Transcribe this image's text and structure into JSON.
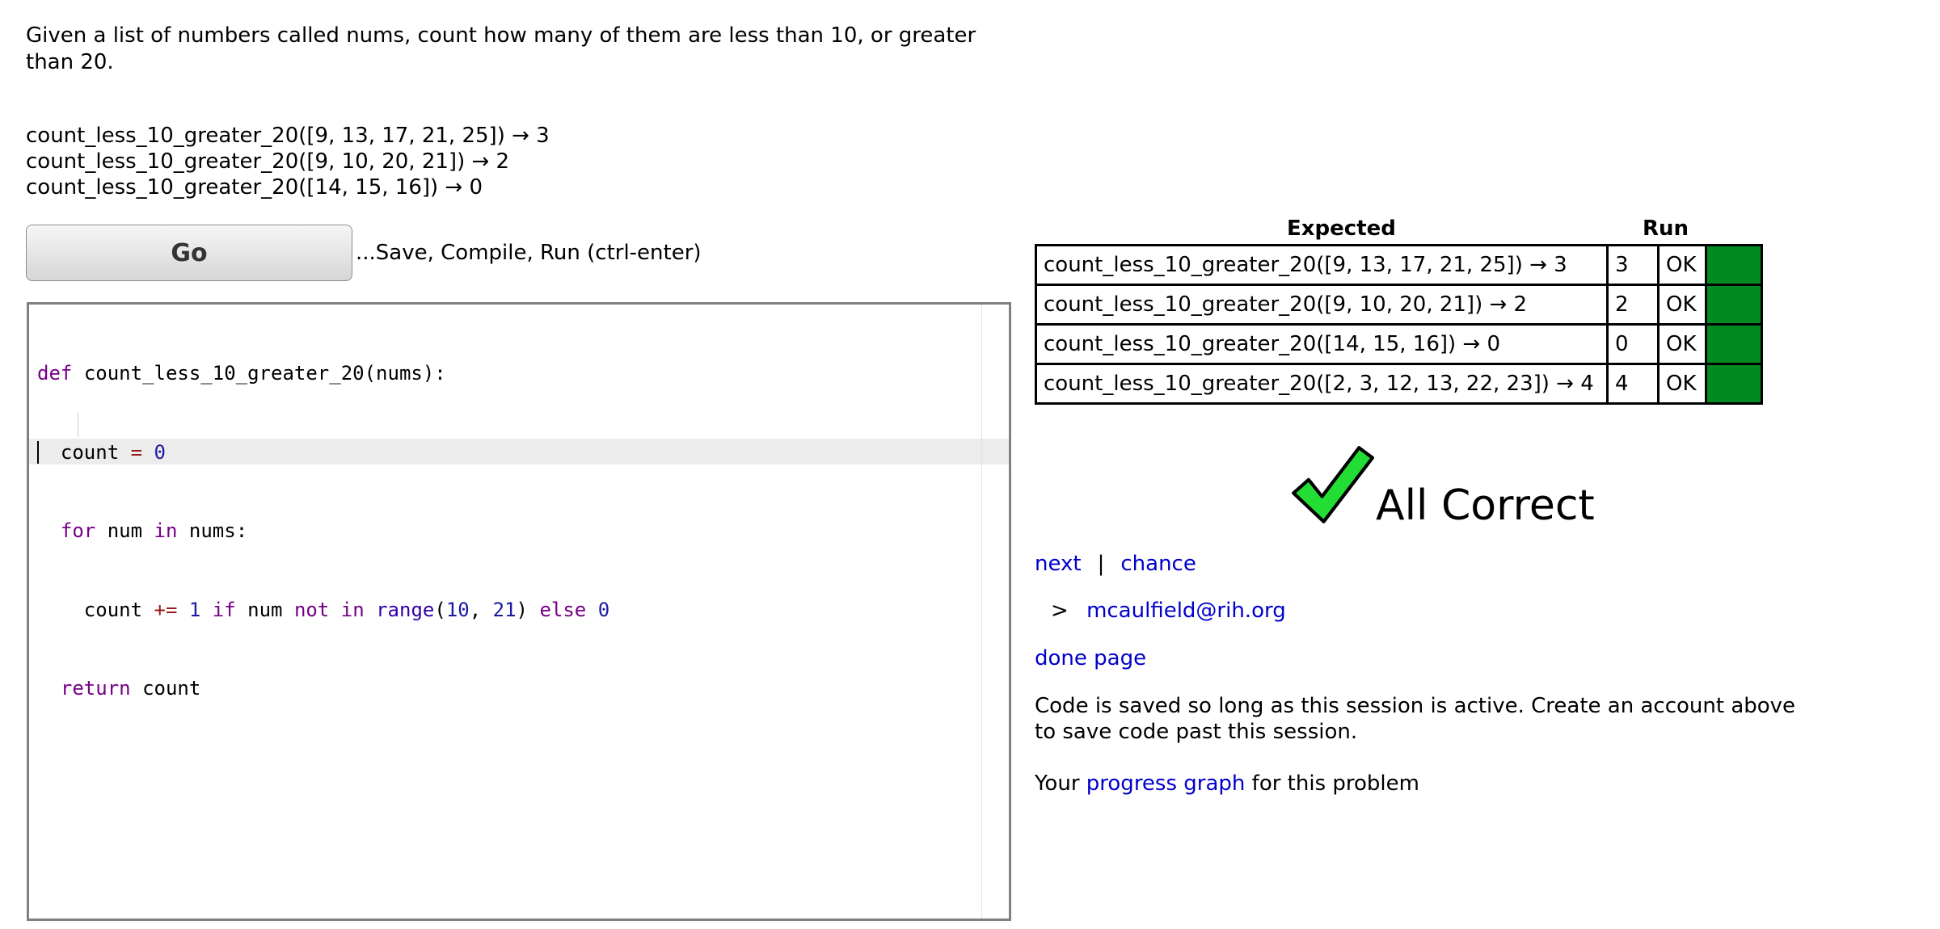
{
  "problem": {
    "description": "Given a list of numbers called nums, count how many of them are less than 10, or greater than 20.",
    "examples": [
      "count_less_10_greater_20([9, 13, 17, 21, 25]) → 3",
      "count_less_10_greater_20([9, 10, 20, 21]) → 2",
      "count_less_10_greater_20([14, 15, 16]) → 0"
    ]
  },
  "toolbar": {
    "go_label": "Go",
    "go_hint": "...Save, Compile, Run (ctrl-enter)"
  },
  "editor": {
    "lines": [
      "def count_less_10_greater_20(nums):",
      "  count = 0",
      "  for num in nums:",
      "    count += 1 if num not in range(10, 21) else 0",
      "  return count",
      ""
    ]
  },
  "results": {
    "headers": {
      "expected": "Expected",
      "run": "Run"
    },
    "rows": [
      {
        "expected": "count_less_10_greater_20([9, 13, 17, 21, 25]) → 3",
        "run": "3",
        "status": "OK"
      },
      {
        "expected": "count_less_10_greater_20([9, 10, 20, 21]) → 2",
        "run": "2",
        "status": "OK"
      },
      {
        "expected": "count_less_10_greater_20([14, 15, 16]) → 0",
        "run": "0",
        "status": "OK"
      },
      {
        "expected": "count_less_10_greater_20([2, 3, 12, 13, 22, 23]) → 4",
        "run": "4",
        "status": "OK"
      }
    ],
    "pass_color": "#008a20",
    "summary": "All Correct"
  },
  "nav": {
    "next": "next",
    "separator": "|",
    "chance": "chance",
    "user_prefix": ">",
    "user_email": "mcaulfield@rih.org",
    "done_page": "done page"
  },
  "notes": {
    "session": "Code is saved so long as this session is active. Create an account above to save code past this session.",
    "progress_prefix": "Your",
    "progress_link": "progress graph",
    "progress_suffix": "for this problem"
  },
  "icons": {
    "success": "checkmark-icon"
  }
}
